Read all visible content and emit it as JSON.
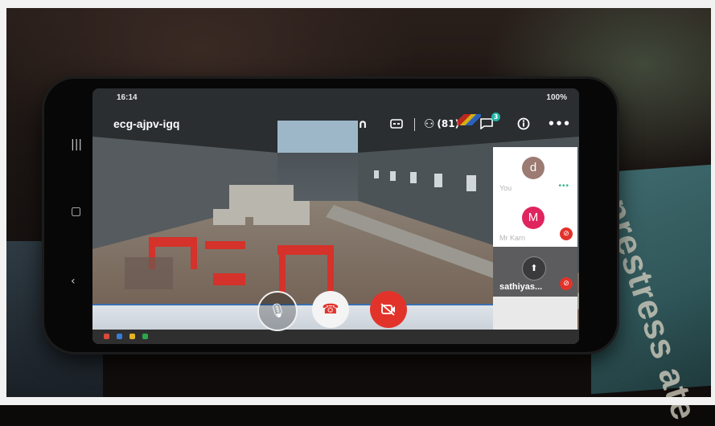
{
  "statusbar": {
    "time": "16:14",
    "right": "100%"
  },
  "call": {
    "meeting_code": "ecg-ajpv-igq",
    "participant_count": "(81)",
    "chat_badge": "3"
  },
  "icons": {
    "audio": "headphones-icon",
    "captions": "captions-icon",
    "people": "people-icon",
    "chat": "chat-icon",
    "info": "info-icon",
    "more": "more-icon"
  },
  "participants": [
    {
      "initial": "d",
      "name": "You",
      "avatar_color": "#9c7b72",
      "status": "speaking-dots"
    },
    {
      "initial": "M",
      "name": "Mr Karn",
      "avatar_color": "#e0245e",
      "status": "muted"
    },
    {
      "initial": "⬆",
      "name": "sathiyas...",
      "avatar_color": "#3a3a3c",
      "status": "muted"
    }
  ],
  "controls": {
    "mic": "mic-icon",
    "end": "end-call-icon",
    "camera": "camera-off-icon"
  },
  "colors": {
    "end_red": "#e2332b",
    "badge_teal": "#1fb5a5",
    "you_dots": "#33b585"
  },
  "overlay": {
    "strip_line1": "",
    "strip_line2": "",
    "book_text": "prestress ate"
  }
}
